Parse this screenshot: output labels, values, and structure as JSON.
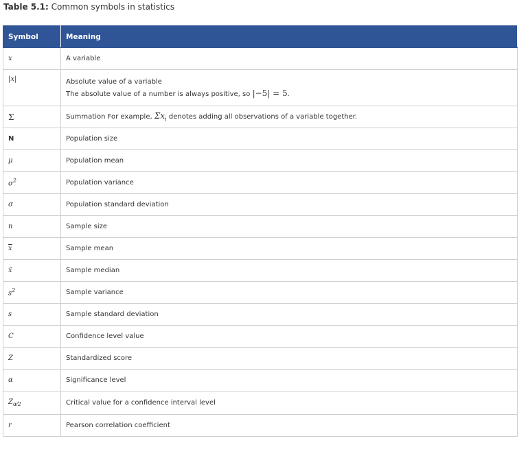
{
  "caption": {
    "number": "Table 5.1:",
    "title": "Common symbols in statistics"
  },
  "headers": {
    "symbol": "Symbol",
    "meaning": "Meaning"
  },
  "rows": [
    {
      "symbol": "x",
      "meaning": "A variable"
    },
    {
      "symbol": "|x|",
      "meaning": "Absolute value of a variable",
      "meaning2": "The absolute value of a number is always positive, so",
      "example": "|−5| = 5",
      "example_tail": "."
    },
    {
      "symbol": "Σ",
      "meaning": "Summation For example,",
      "sum_expr": "Σx",
      "sum_sub": "i",
      "meaning_tail": "denotes adding all observations of a variable together."
    },
    {
      "symbol": "N",
      "meaning": "Population size"
    },
    {
      "symbol": "μ",
      "meaning": "Population mean"
    },
    {
      "symbol": "σ",
      "sup": "2",
      "meaning": "Population variance"
    },
    {
      "symbol": "σ",
      "meaning": "Population standard deviation"
    },
    {
      "symbol": "n",
      "meaning": "Sample size"
    },
    {
      "symbol": "x",
      "meaning": "Sample mean"
    },
    {
      "symbol": "x̃",
      "meaning": "Sample median"
    },
    {
      "symbol": "s",
      "sup": "2",
      "meaning": "Sample variance"
    },
    {
      "symbol": "s",
      "meaning": "Sample standard deviation"
    },
    {
      "symbol": "C",
      "meaning": "Confidence level value"
    },
    {
      "symbol": "Z",
      "meaning": "Standardized score"
    },
    {
      "symbol": "α",
      "meaning": "Significance level"
    },
    {
      "symbol": "Z",
      "sub": "α⁄2",
      "meaning": "Critical value for a confidence interval level"
    },
    {
      "symbol": "r",
      "meaning": "Pearson correlation coefficient"
    }
  ]
}
